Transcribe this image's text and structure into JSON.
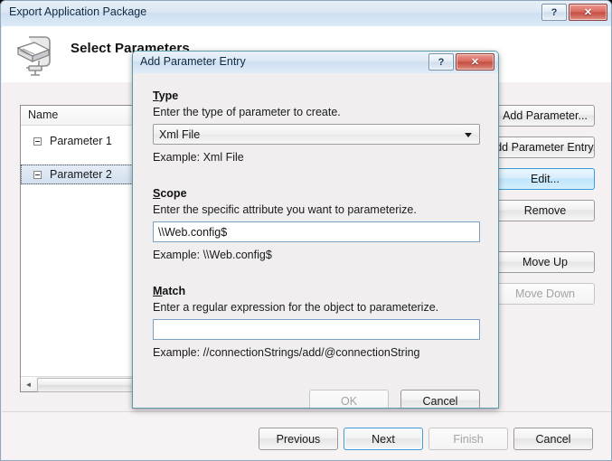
{
  "outer_window": {
    "title": "Export Application Package",
    "help_button": "?",
    "close_button": "✕",
    "header_title": "Select Parameters",
    "header_icon": "package-wizard-icon"
  },
  "tree": {
    "column_header": "Name",
    "rows": [
      {
        "label": "Parameter 1",
        "selected": false,
        "expander": "collapse-box"
      },
      {
        "label": "Parameter 2",
        "selected": true,
        "expander": "collapse-box"
      }
    ],
    "hscroll_left_arrow": "◄"
  },
  "side_buttons": [
    {
      "label": "Add Parameter...",
      "state": "normal"
    },
    {
      "label": "Add Parameter Entry...",
      "state": "normal"
    },
    {
      "label": "Edit...",
      "state": "hover"
    },
    {
      "label": "Remove",
      "state": "normal"
    },
    {
      "label": "Move Up",
      "state": "normal"
    },
    {
      "label": "Move Down",
      "state": "disabled"
    }
  ],
  "footer_buttons": [
    {
      "label": "Previous",
      "state": "normal"
    },
    {
      "label": "Next",
      "state": "default"
    },
    {
      "label": "Finish",
      "state": "disabled"
    },
    {
      "label": "Cancel",
      "state": "normal"
    }
  ],
  "inner_dialog": {
    "title": "Add Parameter Entry",
    "help_button": "?",
    "close_button": "✕",
    "fields": {
      "type": {
        "label": "Type",
        "accel": "T",
        "description": "Enter the type of parameter to create.",
        "value": "Xml File",
        "example": "Example: Xml File",
        "options": [
          "Xml File"
        ]
      },
      "scope": {
        "label": "Scope",
        "accel": "S",
        "description": "Enter the specific attribute you want to parameterize.",
        "value": "\\\\Web.config$",
        "placeholder": "",
        "example": "Example: \\\\Web.config$"
      },
      "match": {
        "label": "Match",
        "accel": "M",
        "description": "Enter a regular expression for the object to parameterize.",
        "value": "",
        "placeholder": "",
        "example": "Example: //connectionStrings/add/@connectionString"
      }
    },
    "buttons": [
      {
        "label": "OK",
        "state": "disabled"
      },
      {
        "label": "Cancel",
        "state": "normal"
      }
    ]
  },
  "colors": {
    "titlebar_accent": "#cfdff0",
    "close_red": "#c44c42",
    "selection_blue": "#d3e0f0",
    "hover_blue": "#bfe5fb",
    "inner_border_teal": "#5a9aa8",
    "body_gray": "#f0eeee"
  }
}
